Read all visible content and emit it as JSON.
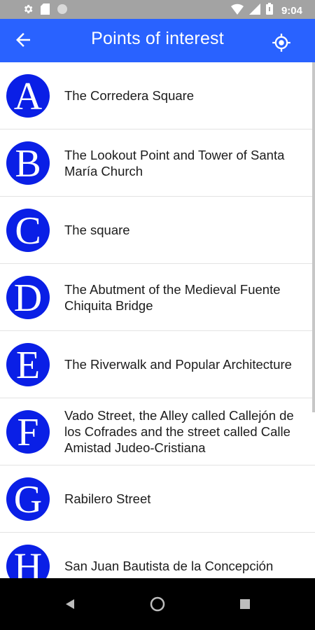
{
  "status_bar": {
    "time": "9:04",
    "icons": [
      "settings-icon",
      "sd-card-icon",
      "circle-icon",
      "wifi-icon",
      "signal-icon",
      "battery-icon"
    ]
  },
  "app_bar": {
    "title": "Points of interest",
    "back_icon": "arrow-back-icon",
    "action_icon": "my-location-icon",
    "color": "#2962ff"
  },
  "badge_color": "#0a1fe6",
  "points": [
    {
      "letter": "A",
      "name": "The Corredera Square"
    },
    {
      "letter": "B",
      "name": "The Lookout Point and Tower of Santa María Church"
    },
    {
      "letter": "C",
      "name": "The square"
    },
    {
      "letter": "D",
      "name": "The Abutment of the Medieval Fuente Chiquita Bridge"
    },
    {
      "letter": "E",
      "name": "The Riverwalk and Popular Architecture"
    },
    {
      "letter": "F",
      "name": "Vado Street, the Alley called Callejón de los Cofrades and the street called Calle Amistad Judeo-Cristiana"
    },
    {
      "letter": "G",
      "name": "Rabilero Street"
    },
    {
      "letter": "H",
      "name": "San Juan Bautista de la Concepción"
    }
  ],
  "nav_bar": {
    "icons": [
      "back-triangle-icon",
      "home-circle-icon",
      "recents-square-icon"
    ]
  }
}
